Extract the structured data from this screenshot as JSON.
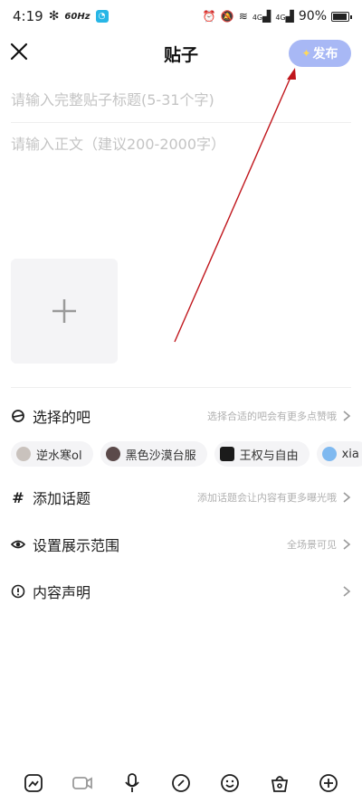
{
  "status_bar": {
    "time": "4:19",
    "refresh": "60Hz",
    "network1": "4G",
    "network2": "4G",
    "battery": "90%"
  },
  "header": {
    "title": "贴子",
    "publish_label": "发布",
    "close_icon": "close-icon"
  },
  "form": {
    "title_placeholder": "请输入完整贴子标题(5-31个字)",
    "body_placeholder": "请输入正文（建议200-2000字）"
  },
  "options": {
    "bar": {
      "label": "选择的吧",
      "hint": "选择合适的吧会有更多点赞哦"
    },
    "topic": {
      "label": "添加话题",
      "hint": "添加话题会让内容有更多曝光哦"
    },
    "visibility": {
      "label": "设置展示范围",
      "hint": "全场景可见"
    },
    "declaration": {
      "label": "内容声明",
      "hint": ""
    }
  },
  "bar_chips": [
    {
      "name": "逆水寒ol",
      "color": "#c9c2bd"
    },
    {
      "name": "黑色沙漠台服",
      "color": "#5b4a4a"
    },
    {
      "name": "王权与自由",
      "color": "#1b1b1b"
    },
    {
      "name": "xia",
      "color": "#7fb9f0"
    }
  ],
  "toolbar": {
    "icons": [
      "sticker-icon",
      "video-icon",
      "microphone-icon",
      "link-icon",
      "emoji-icon",
      "bag-icon",
      "add-icon"
    ]
  },
  "annotation": {
    "color": "#c0161c"
  },
  "colors": {
    "publish_bg": "#a8b8f5",
    "placeholder": "#c4c4c4"
  }
}
